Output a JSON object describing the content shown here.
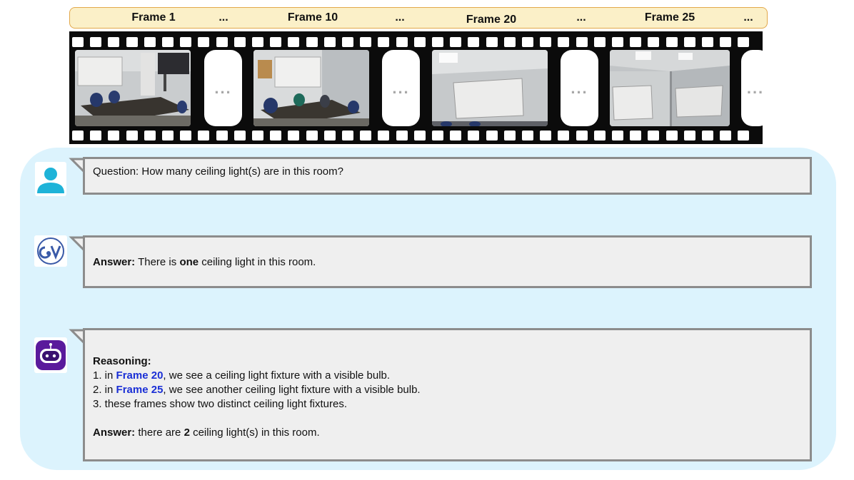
{
  "header": {
    "frames": [
      "Frame 1",
      "Frame 10",
      "Frame 20",
      "Frame 25"
    ],
    "ellipsis": "..."
  },
  "filmstrip": {
    "gap_ellipsis": "...",
    "photos": [
      {
        "scene": "conference-room-with-tv"
      },
      {
        "scene": "conference-room-with-board"
      },
      {
        "scene": "ceiling-light-whiteboard"
      },
      {
        "scene": "ceiling-fixture-whiteboard"
      }
    ]
  },
  "chat": {
    "question": "Question: How many ceiling light(s) are in this room?",
    "baseline": {
      "answer_label": "Answer:",
      "answer_pre": " There is ",
      "answer_bold": "one",
      "answer_post": " ceiling light in this room."
    },
    "model": {
      "reasoning_label": "Reasoning:",
      "steps": [
        {
          "pre": "1. in ",
          "frame": "Frame 20",
          "post": ", we see a ceiling light fixture with a visible bulb."
        },
        {
          "pre": "2. in ",
          "frame": "Frame 25",
          "post": ", we see another ceiling light fixture with a visible bulb."
        },
        {
          "pre": "3. these frames show two distinct ceiling light fixtures.",
          "frame": "",
          "post": ""
        }
      ],
      "answer_label": "Answer:",
      "answer_pre": " there are ",
      "answer_bold": "2",
      "answer_post": " ceiling light(s) in this room."
    }
  },
  "icons": {
    "user": "user-icon",
    "baseline": "ov-logo-icon",
    "model": "robot-icon"
  },
  "colors": {
    "header_fill": "#fbf0c8",
    "header_border": "#e2a84b",
    "panel_bg": "#dcf3fd",
    "bubble_fill": "#efefef",
    "bubble_border": "#8c8c8c",
    "frame_ref": "#1a2fd6",
    "user_icon": "#1eb3d8",
    "robot_icon": "#5a1a9c"
  }
}
